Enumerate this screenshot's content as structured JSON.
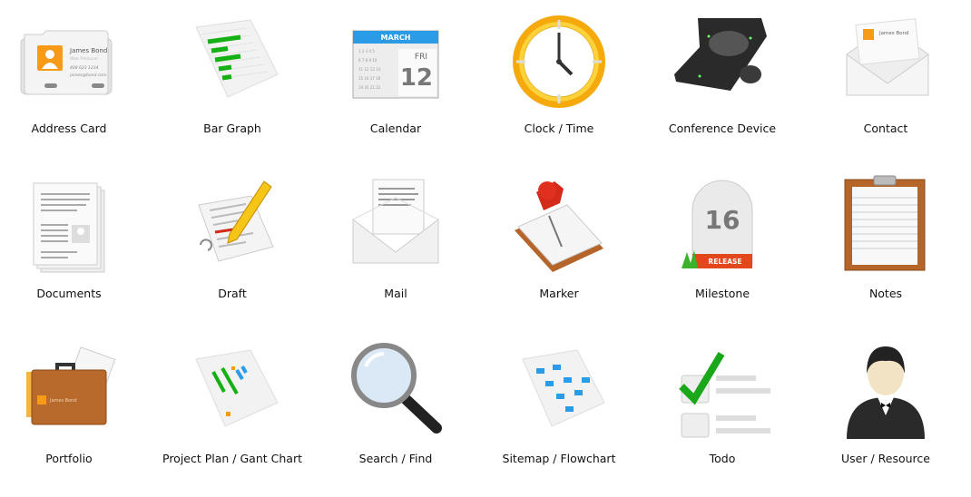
{
  "items": [
    {
      "label": "Address Card",
      "name": "James Bond",
      "title": "Web Producer",
      "phone": "408 623 1234",
      "email": "james@bond.com"
    },
    {
      "label": "Bar Graph"
    },
    {
      "label": "Calendar",
      "month": "MARCH",
      "weekday": "FRI",
      "day": "12"
    },
    {
      "label": "Clock / Time"
    },
    {
      "label": "Conference Device"
    },
    {
      "label": "Contact",
      "name": "James Bond"
    },
    {
      "label": "Documents"
    },
    {
      "label": "Draft"
    },
    {
      "label": "Mail"
    },
    {
      "label": "Marker"
    },
    {
      "label": "Milestone",
      "number": "16",
      "tag": "RELEASE"
    },
    {
      "label": "Notes"
    },
    {
      "label": "Portfolio",
      "name": "James Bond"
    },
    {
      "label": "Project Plan / Gant Chart"
    },
    {
      "label": "Search / Find"
    },
    {
      "label": "Sitemap / Flowchart"
    },
    {
      "label": "Todo"
    },
    {
      "label": "User / Resource"
    }
  ],
  "colors": {
    "orange": "#f7a21b",
    "green": "#1aa81a",
    "blue": "#2a9be6",
    "red": "#d42a1a",
    "brown": "#b5652a"
  }
}
